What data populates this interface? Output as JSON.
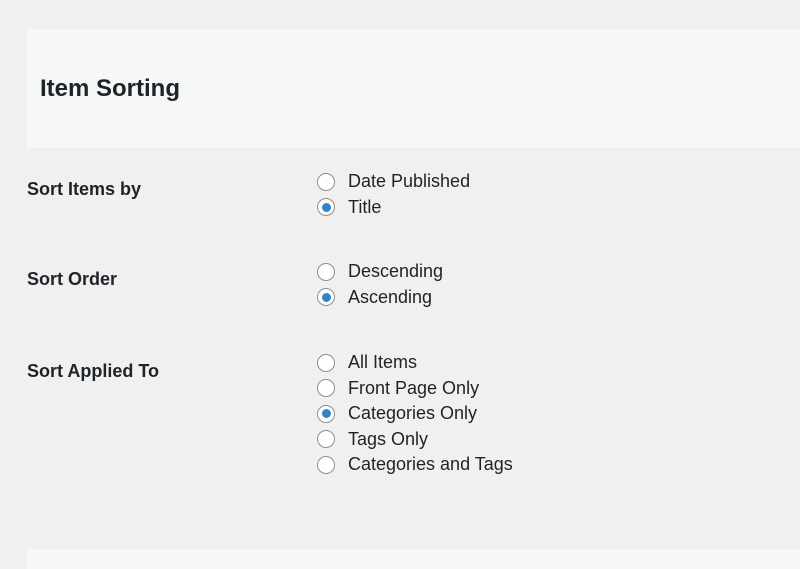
{
  "section": {
    "title": "Item Sorting"
  },
  "settings": [
    {
      "label": "Sort Items by",
      "options": [
        {
          "label": "Date Published",
          "checked": false
        },
        {
          "label": "Title",
          "checked": true
        }
      ]
    },
    {
      "label": "Sort Order",
      "options": [
        {
          "label": "Descending",
          "checked": false
        },
        {
          "label": "Ascending",
          "checked": true
        }
      ]
    },
    {
      "label": "Sort Applied To",
      "options": [
        {
          "label": "All Items",
          "checked": false
        },
        {
          "label": "Front Page Only",
          "checked": false
        },
        {
          "label": "Categories Only",
          "checked": true
        },
        {
          "label": "Tags Only",
          "checked": false
        },
        {
          "label": "Categories and Tags",
          "checked": false
        }
      ]
    }
  ],
  "colors": {
    "radio_accent": "#3582c4",
    "page_background": "#f0f0f1",
    "header_background": "#f6f7f7",
    "text": "#1d2327"
  }
}
